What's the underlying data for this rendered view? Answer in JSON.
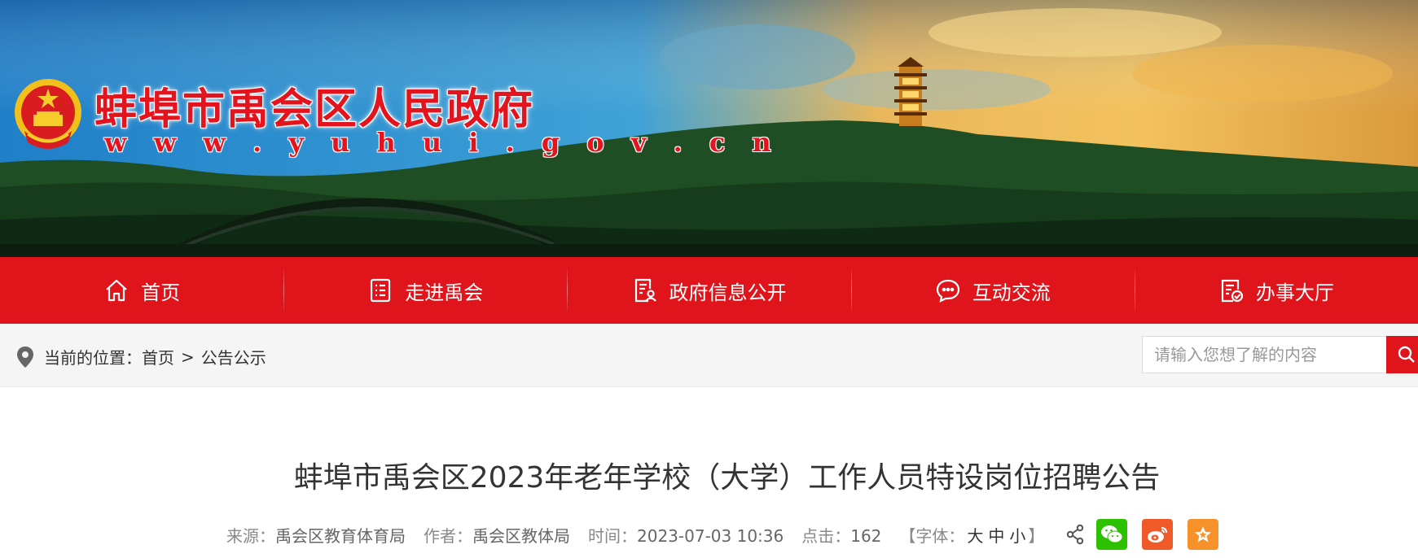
{
  "header": {
    "site_title": "蚌埠市禹会区人民政府",
    "site_url": "w w w . y u h u i . g o v . c n"
  },
  "nav": {
    "items": [
      {
        "label": "首页",
        "icon": "home-icon"
      },
      {
        "label": "走进禹会",
        "icon": "list-icon"
      },
      {
        "label": "政府信息公开",
        "icon": "document-user-icon"
      },
      {
        "label": "互动交流",
        "icon": "chat-bubble-icon"
      },
      {
        "label": "办事大厅",
        "icon": "clipboard-check-icon"
      }
    ]
  },
  "breadcrumb": {
    "prefix": "当前的位置：",
    "home": "首页",
    "separator": ">",
    "current": "公告公示"
  },
  "search": {
    "placeholder": "请输入您想了解的内容"
  },
  "article": {
    "title": "蚌埠市禹会区2023年老年学校（大学）工作人员特设岗位招聘公告",
    "meta": {
      "source_label": "来源：",
      "source_value": "禹会区教育体育局",
      "author_label": "作者：",
      "author_value": "禹会区教体局",
      "time_label": "时间：",
      "time_value": "2023-07-03 10:36",
      "clicks_label": "点击：",
      "clicks_value": "162",
      "font_label": "【字体：",
      "font_large": "大",
      "font_medium": "中",
      "font_small": "小",
      "font_close": "】"
    }
  },
  "colors": {
    "brand_red": "#e0141b",
    "wechat_green": "#2dc100",
    "weibo_orange": "#ef5a28",
    "favorite_orange": "#f7922b"
  }
}
